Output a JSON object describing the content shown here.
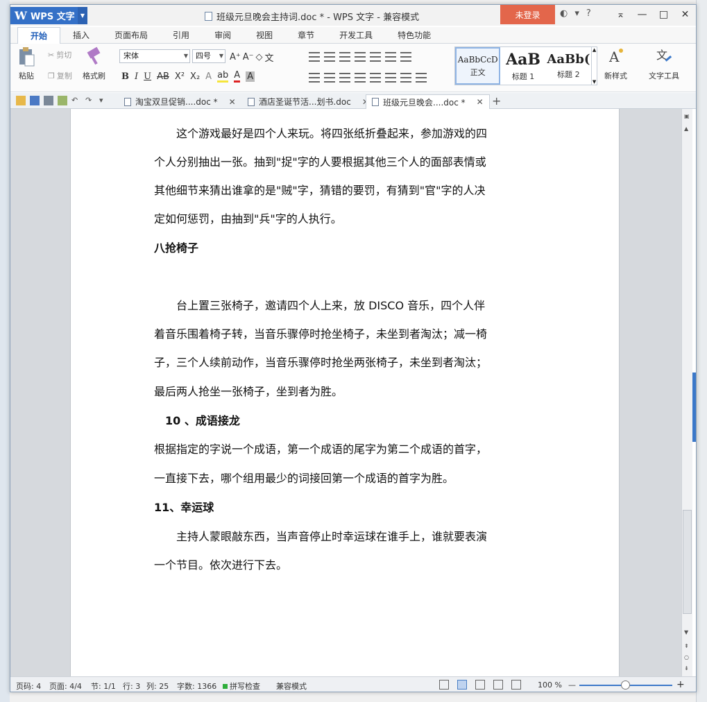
{
  "window": {
    "app_name": "WPS 文字",
    "logo": "W",
    "title": "班级元旦晚会主持词.doc * - WPS 文字 - 兼容模式",
    "login": "未登录"
  },
  "ribbon_tabs": [
    "开始",
    "插入",
    "页面布局",
    "引用",
    "审阅",
    "视图",
    "章节",
    "开发工具",
    "特色功能"
  ],
  "ribbon": {
    "paste": "粘贴",
    "cut": "剪切",
    "copy": "复制",
    "format_painter": "格式刷",
    "font": "宋体",
    "size": "四号",
    "bold": "B",
    "italic": "I",
    "underline": "U",
    "strike": "AB",
    "sup": "X²",
    "sub": "X₂",
    "styles": [
      {
        "sample": "AaBbCcD",
        "label": "正文"
      },
      {
        "sample": "AaB",
        "label": "标题 1"
      },
      {
        "sample": "AaBb(",
        "label": "标题 2"
      }
    ],
    "new_style": "新样式",
    "text_tool": "文字工具"
  },
  "doc_tabs": [
    {
      "label": "淘宝双旦促销....doc *"
    },
    {
      "label": "酒店圣诞节活...划书.doc"
    },
    {
      "label": "班级元旦晚会....doc *"
    }
  ],
  "document": {
    "lines": [
      "　　这个游戏最好是四个人来玩。将四张纸折叠起来，参加游戏的四",
      "个人分别抽出一张。抽到\"捉\"字的人要根据其他三个人的面部表情或",
      "其他细节来猜出谁拿的是\"贼\"字，猜错的要罚，有猜到\"官\"字的人决",
      "定如何惩罚，由抽到\"兵\"字的人执行。"
    ],
    "heading8": "八抢椅子",
    "lines8": [
      "　　台上置三张椅子，邀请四个人上来，放 DISCO 音乐，四个人伴",
      "着音乐围着椅子转，当音乐骤停时抢坐椅子，未坐到者淘汰；减一椅",
      "子，三个人续前动作，当音乐骤停时抢坐两张椅子，未坐到者淘汰；",
      "最后两人抢坐一张椅子，坐到者为胜。"
    ],
    "heading10": "　10 、成语接龙",
    "lines10": [
      "根据指定的字说一个成语，第一个成语的尾字为第二个成语的首字，",
      "一直接下去，哪个组用最少的词接回第一个成语的首字为胜。"
    ],
    "heading11": "11、幸运球",
    "lines11": [
      "　　主持人蒙眼敲东西，当声音停止时幸运球在谁手上，谁就要表演",
      "一个节目。依次进行下去。"
    ]
  },
  "status": {
    "page": "页码: 4",
    "pages": "页面: 4/4",
    "section": "节: 1/1",
    "row": "行: 3",
    "col": "列: 25",
    "words": "字数: 1366",
    "spell": "拼写检查",
    "mode": "兼容模式",
    "zoom": "100 %"
  }
}
